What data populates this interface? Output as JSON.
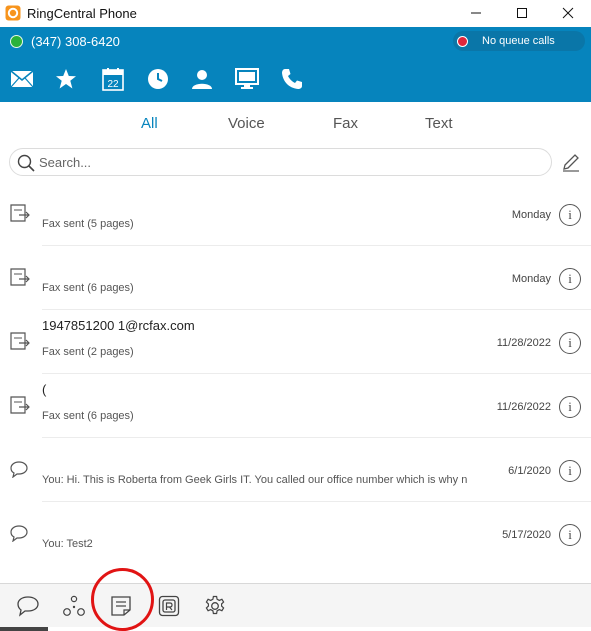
{
  "window": {
    "title": "RingCentral Phone",
    "controls": [
      "minimize",
      "maximize",
      "close"
    ]
  },
  "status": {
    "presence_color": "#2ab23a",
    "phone_number": "(347) 308-6420",
    "queue_label": "No queue calls",
    "queue_dot_color": "#e0263b"
  },
  "nav": {
    "icons": [
      "messages-icon",
      "favorites-icon",
      "calendar-icon",
      "history-icon",
      "contacts-icon",
      "meetings-icon",
      "phone-icon"
    ],
    "calendar_day": "22"
  },
  "tabs": [
    {
      "label": "All",
      "active": true
    },
    {
      "label": "Voice",
      "active": false
    },
    {
      "label": "Fax",
      "active": false
    },
    {
      "label": "Text",
      "active": false
    }
  ],
  "search": {
    "placeholder": "Search..."
  },
  "messages": [
    {
      "type": "fax",
      "title": "",
      "subtitle": "Fax sent (5 pages)",
      "date": "Monday"
    },
    {
      "type": "fax",
      "title": "",
      "subtitle": "Fax sent (6 pages)",
      "date": "Monday"
    },
    {
      "type": "fax",
      "title": "1947851200 1@rcfax.com",
      "subtitle": "Fax sent (2 pages)",
      "date": "11/28/2022"
    },
    {
      "type": "fax",
      "title": "(",
      "subtitle": "Fax sent (6 pages)",
      "date": "11/26/2022"
    },
    {
      "type": "text",
      "title": "",
      "subtitle": "You: Hi. This is Roberta from Geek Girls IT. You called our office number which is why n",
      "date": "6/1/2020"
    },
    {
      "type": "text",
      "title": "",
      "subtitle": "You: Test2",
      "date": "5/17/2020"
    }
  ],
  "bottom_nav": {
    "icons": [
      "chat-icon",
      "glip-icon",
      "notes-icon",
      "rc-app-icon",
      "settings-icon"
    ],
    "highlighted": "notes-icon",
    "highlight_color": "#e11414"
  },
  "colors": {
    "brand_blue": "#0684bd",
    "active_tab": "#0684bd"
  }
}
